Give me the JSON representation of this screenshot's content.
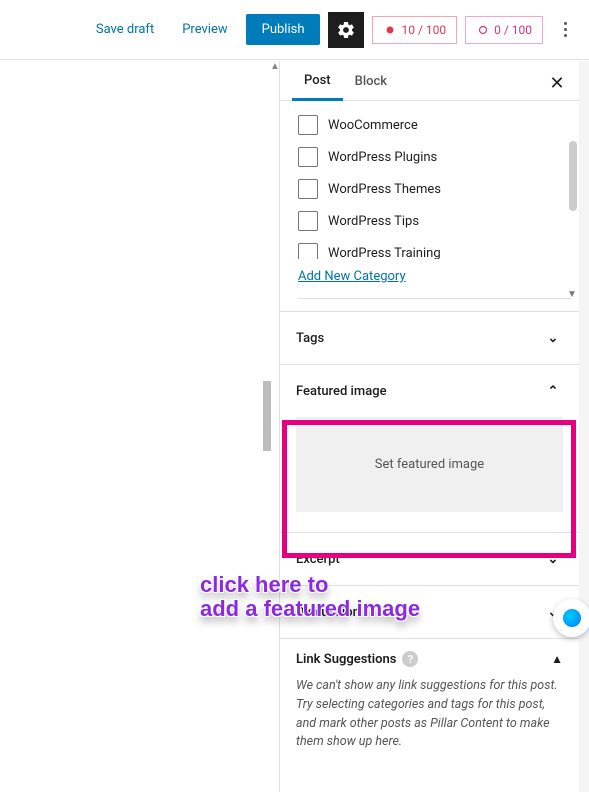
{
  "topbar": {
    "save_draft": "Save draft",
    "preview": "Preview",
    "publish": "Publish",
    "score1": "10 / 100",
    "score2": "0 / 100"
  },
  "tabs": {
    "post": "Post",
    "block": "Block"
  },
  "categories": {
    "items": [
      "WooCommerce",
      "WordPress Plugins",
      "WordPress Themes",
      "WordPress Tips",
      "WordPress Training"
    ],
    "add_new": "Add New Category"
  },
  "sections": {
    "tags": "Tags",
    "featured_image": "Featured image",
    "set_featured": "Set featured image",
    "excerpt": "Excerpt",
    "discussion": "Discussion",
    "link_suggestions": "Link Suggestions",
    "link_suggestions_body": "We can't show any link suggestions for this post. Try selecting categories and tags for this post, and mark other posts as Pillar Content to make them show up here."
  },
  "annotation": {
    "line1": "click here to",
    "line2": "add a featured image"
  }
}
